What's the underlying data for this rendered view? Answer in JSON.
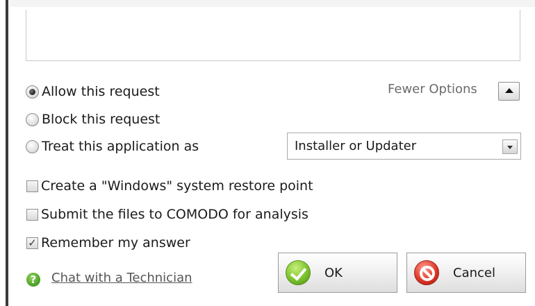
{
  "options": {
    "fewer_options_label": "Fewer Options",
    "radio_allow": "Allow this request",
    "radio_block": "Block this request",
    "radio_treat": "Treat this application as",
    "treat_as_selected": "Installer or Updater",
    "selected_radio": "allow"
  },
  "checkboxes": {
    "restore_point": "Create a \"Windows\" system restore point",
    "submit_files": "Submit the files to COMODO for analysis",
    "remember": "Remember my answer",
    "checked": [
      "remember"
    ]
  },
  "footer": {
    "chat_link": "Chat with a Technician",
    "ok_label": "OK",
    "cancel_label": "Cancel"
  },
  "icons": {
    "help": "help-question-icon",
    "ok": "checkmark-icon",
    "cancel": "cancel-icon",
    "fewer": "chevron-up-icon",
    "dropdown": "chevron-down-icon"
  },
  "colors": {
    "ok_green": "#7cc22d",
    "cancel_red": "#e0392a",
    "help_green": "#4a9d25"
  }
}
